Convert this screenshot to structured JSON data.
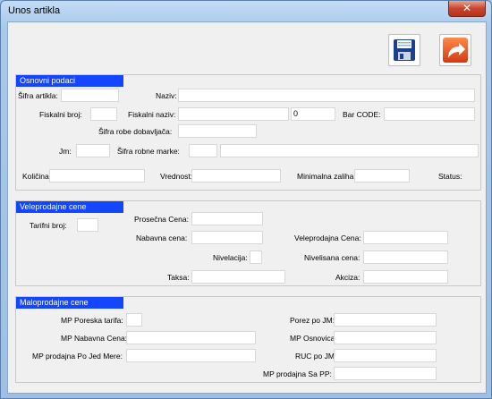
{
  "window": {
    "title": "Unos artikla",
    "close_glyph": "✕"
  },
  "toolbar": {
    "save_icon": "floppy-disk-icon",
    "exit_icon": "curved-arrow-icon"
  },
  "osnovni": {
    "header": "Osnovni podaci",
    "sifra_artikla": "Šifra artikla:",
    "naziv": "Naziv:",
    "fiskalni_broj": "Fiskalni broj:",
    "fiskalni_naziv": "Fiskalni naziv:",
    "fiskalni_value": "0",
    "bar_code": "Bar CODE:",
    "sifra_robe_dob": "Šifra robe dobavljača:",
    "jm": "Jm:",
    "sifra_robne_marke": "Šifra robne marke:",
    "kolicina": "Količina:",
    "vrednost": "Vrednost:",
    "minimalna_zaliha": "Minimalna zaliha:",
    "status": "Status:"
  },
  "veleprodajne": {
    "header": "Veleprodajne cene",
    "tarifni_broj": "Tarifni broj:",
    "prosecna_cena": "Prosečna Cena:",
    "nabavna_cena": "Nabavna cena:",
    "veleprodajna_cena": "Veleprodajna Cena:",
    "nivelacija": "Nivelacija:",
    "nivelisana_cena": "Nivelisana cena:",
    "taksa": "Taksa:",
    "akciza": "Akciza:"
  },
  "maloprodajne": {
    "header": "Maloprodajne cene",
    "mp_poreska_tarifa": "MP Poreska tarifa:",
    "porez_po_jm": "Porez po JM:",
    "mp_nabavna_cena": "MP Nabavna Cena:",
    "mp_osnovica": "MP Osnovica:",
    "mp_prodajna_jed": "MP prodajna Po Jed Mere:",
    "ruc_po_jm": "RUC po JM:",
    "mp_prodajna_pp": "MP prodajna Sa PP:"
  }
}
